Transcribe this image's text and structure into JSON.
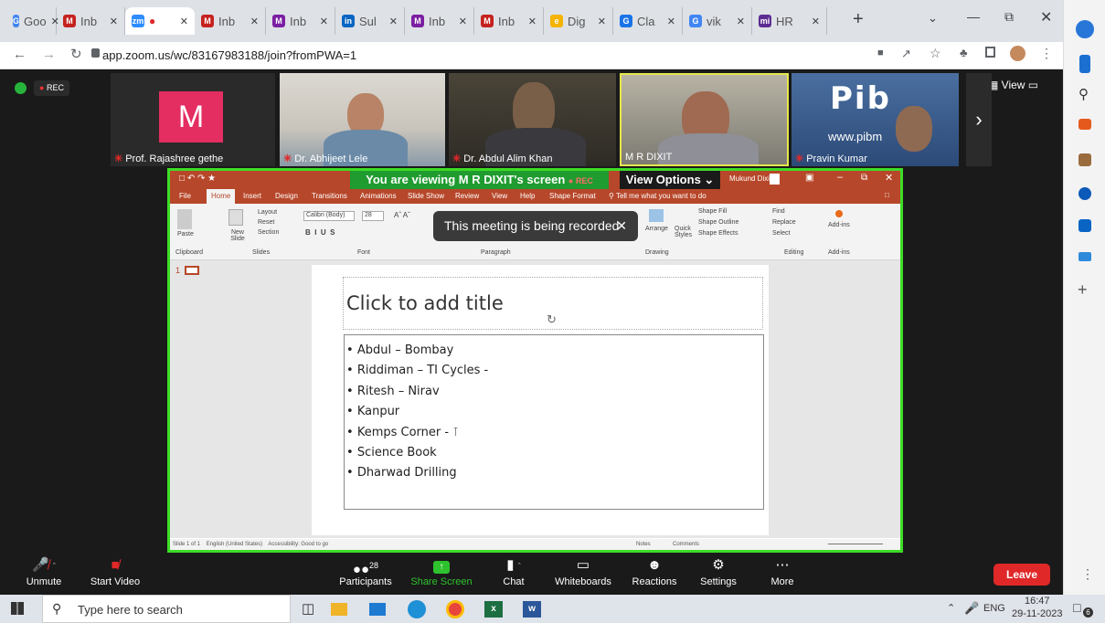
{
  "browser": {
    "tabs": [
      {
        "label": "Goo",
        "fav": "G",
        "color": "#4285f4"
      },
      {
        "label": "Inb",
        "fav": "M",
        "color": "#c5221f"
      },
      {
        "label": "",
        "fav": "zm",
        "color": "#2d8cff"
      },
      {
        "label": "Inb",
        "fav": "M",
        "color": "#c5221f"
      },
      {
        "label": "Inb",
        "fav": "M",
        "color": "#7b1fa2"
      },
      {
        "label": "Sul",
        "fav": "in",
        "color": "#0a66c2"
      },
      {
        "label": "Inb",
        "fav": "M",
        "color": "#7b1fa2"
      },
      {
        "label": "Inb",
        "fav": "M",
        "color": "#c5221f"
      },
      {
        "label": "Dig",
        "fav": "e",
        "color": "#f4b400"
      },
      {
        "label": "Cla",
        "fav": "G",
        "color": "#1a73e8"
      },
      {
        "label": "vik",
        "fav": "G",
        "color": "#4285f4"
      },
      {
        "label": "HR",
        "fav": "mi",
        "color": "#5c2d91"
      }
    ],
    "url": "app.zoom.us/wc/83167983188/join?fromPWA=1"
  },
  "zoom": {
    "rec_label": "REC",
    "view_label": "View",
    "participants_tiles": [
      {
        "name": "Prof. Rajashree gethe",
        "initial": "M",
        "muted": true
      },
      {
        "name": "Dr. Abhijeet Lele",
        "muted": true
      },
      {
        "name": "Dr. Abdul Alim Khan",
        "muted": true
      },
      {
        "name": "M R DIXIT",
        "muted": false
      },
      {
        "name": "Pravin Kumar",
        "muted": true
      }
    ],
    "pib_text": "www.pibm",
    "viewing_banner": "You are viewing  M R DIXIT's screen",
    "view_options": "View Options",
    "toolbar": {
      "unmute": "Unmute",
      "start_video": "Start Video",
      "participants": "Participants",
      "participant_count": "28",
      "share_screen": "Share Screen",
      "chat": "Chat",
      "whiteboards": "Whiteboards",
      "reactions": "Reactions",
      "settings": "Settings",
      "more": "More",
      "leave": "Leave"
    }
  },
  "ppt": {
    "user": "Mukund Dixit",
    "tabs": [
      "File",
      "Home",
      "Insert",
      "Design",
      "Transitions",
      "Animations",
      "Slide Show",
      "Review",
      "View",
      "Help",
      "Shape Format"
    ],
    "tell_me": "Tell me what you want to do",
    "groups": [
      "Clipboard",
      "Slides",
      "Font",
      "Paragraph",
      "Drawing",
      "Editing",
      "Add-ins"
    ],
    "font_name": "Calibri (Body)",
    "font_size": "28",
    "slide_buttons": {
      "layout": "Layout",
      "reset": "Reset",
      "section": "Section",
      "new_slide": "New Slide",
      "paste": "Paste"
    },
    "drawing_buttons": {
      "shape_fill": "Shape Fill",
      "shape_outline": "Shape Outline",
      "shape_effects": "Shape Effects",
      "arrange": "Arrange",
      "quick_styles": "Quick Styles"
    },
    "editing_buttons": {
      "find": "Find",
      "replace": "Replace",
      "select": "Select"
    },
    "addins": "Add-ins",
    "toast": "This meeting is being recorded",
    "slide_number": "1",
    "slide_title": "Click to add title",
    "bullets": [
      "Abdul – Bombay",
      "Riddiman – TI Cycles -",
      "Ritesh – Nirav",
      "Kanpur",
      "Kemps Corner -",
      "Science Book",
      "Dharwad Drilling"
    ],
    "status": {
      "slide": "Slide 1 of 1",
      "language": "English (United States)",
      "accessibility": "Accessibility: Good to go",
      "notes": "Notes",
      "comments": "Comments"
    }
  },
  "taskbar": {
    "search": "Type here to search",
    "lang": "ENG",
    "time": "16:47",
    "date": "29-11-2023",
    "notif_count": "6"
  }
}
